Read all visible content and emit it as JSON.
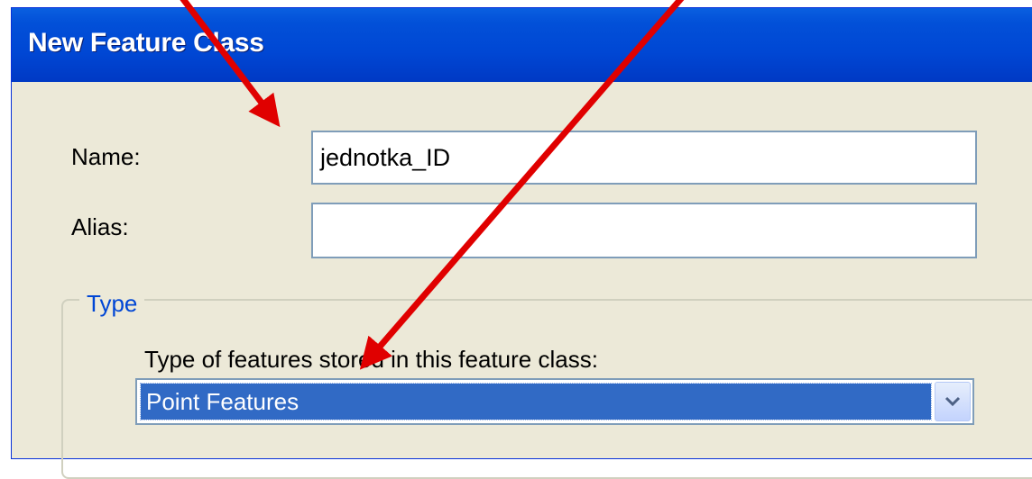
{
  "window": {
    "title": "New Feature Class"
  },
  "name_field": {
    "label": "Name:",
    "value": "jednotka_ID"
  },
  "alias_field": {
    "label": "Alias:",
    "value": ""
  },
  "type_group": {
    "legend": "Type",
    "description": "Type of features stored in this feature class:",
    "selected": "Point Features"
  },
  "colors": {
    "titlebar": "#0047D4",
    "dialog_bg": "#ECE9D8",
    "selection": "#316AC5",
    "legend_text": "#0046D5",
    "annotation_arrow": "#E00000"
  },
  "icons": {
    "dropdown": "chevron-down-icon"
  }
}
